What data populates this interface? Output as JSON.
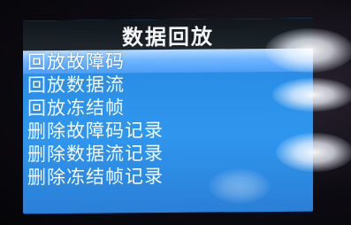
{
  "header": {
    "title": "数据回放"
  },
  "menu": {
    "items": [
      {
        "label": "回放故障码"
      },
      {
        "label": "回放数据流"
      },
      {
        "label": "回放冻结帧"
      },
      {
        "label": "删除故障码记录"
      },
      {
        "label": "删除数据流记录"
      },
      {
        "label": "删除冻结帧记录"
      }
    ],
    "selected_index": 0
  },
  "colors": {
    "screen_background": "#2a8ee6",
    "title_bar": "#161c22",
    "selected_row": "#6fb6ff",
    "text": "#f4f8ff"
  }
}
